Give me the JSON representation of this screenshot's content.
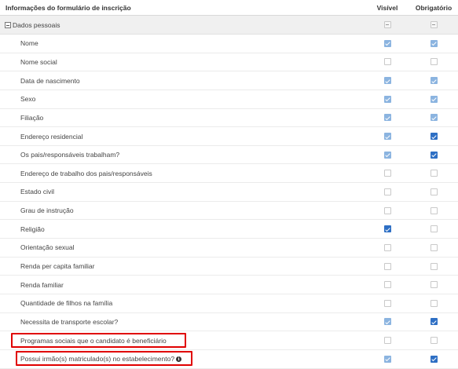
{
  "header": {
    "title": "Informações do formulário de inscrição",
    "visible": "Visível",
    "required": "Obrigatório"
  },
  "group": {
    "label": "Dados pessoais"
  },
  "rows": [
    {
      "label": "Nome",
      "visible": "checked-light",
      "required": "checked-light"
    },
    {
      "label": "Nome social",
      "visible": "unchecked",
      "required": "unchecked"
    },
    {
      "label": "Data de nascimento",
      "visible": "checked-light",
      "required": "checked-light"
    },
    {
      "label": "Sexo",
      "visible": "checked-light",
      "required": "checked-light"
    },
    {
      "label": "Filiação",
      "visible": "checked-light",
      "required": "checked-light"
    },
    {
      "label": "Endereço residencial",
      "visible": "checked-light",
      "required": "checked-dark"
    },
    {
      "label": "Os pais/responsáveis trabalham?",
      "visible": "checked-light",
      "required": "checked-dark"
    },
    {
      "label": "Endereço de trabalho dos pais/responsáveis",
      "visible": "unchecked",
      "required": "unchecked"
    },
    {
      "label": "Estado civil",
      "visible": "unchecked",
      "required": "unchecked"
    },
    {
      "label": "Grau de instrução",
      "visible": "unchecked",
      "required": "unchecked"
    },
    {
      "label": "Religião",
      "visible": "checked-dark",
      "required": "unchecked"
    },
    {
      "label": "Orientação sexual",
      "visible": "unchecked",
      "required": "unchecked"
    },
    {
      "label": "Renda per capita familiar",
      "visible": "unchecked",
      "required": "unchecked"
    },
    {
      "label": "Renda familiar",
      "visible": "unchecked",
      "required": "unchecked"
    },
    {
      "label": "Quantidade de filhos na família",
      "visible": "unchecked",
      "required": "unchecked"
    },
    {
      "label": "Necessita de transporte escolar?",
      "visible": "checked-light",
      "required": "checked-dark"
    },
    {
      "label": "Programas sociais que o candidato é beneficiário",
      "visible": "unchecked",
      "required": "unchecked"
    },
    {
      "label": "Possui irmão(s) matriculado(s) no estabelecimento?",
      "visible": "checked-light",
      "required": "checked-dark",
      "info_icon": "info-circle-icon"
    }
  ],
  "colors": {
    "highlight": "#e00000",
    "checked_light": "#8bb4e0",
    "checked_dark": "#2e6fc4"
  }
}
